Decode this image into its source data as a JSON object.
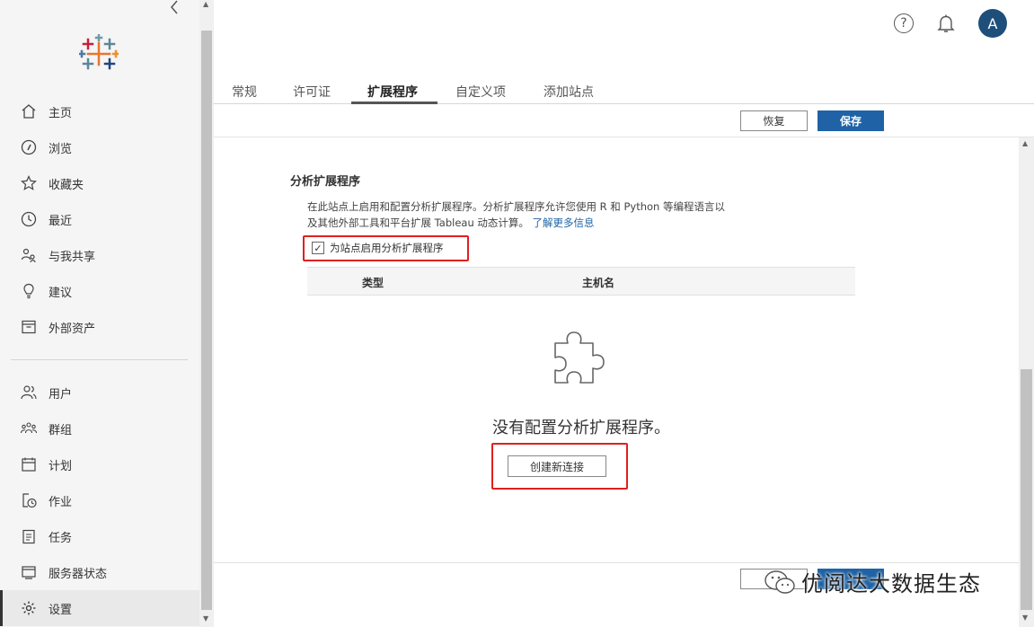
{
  "sidebar": {
    "items": [
      {
        "label": "主页",
        "icon": "home-icon"
      },
      {
        "label": "浏览",
        "icon": "compass-icon"
      },
      {
        "label": "收藏夹",
        "icon": "star-icon"
      },
      {
        "label": "最近",
        "icon": "clock-icon"
      },
      {
        "label": "与我共享",
        "icon": "shared-icon"
      },
      {
        "label": "建议",
        "icon": "lightbulb-icon"
      },
      {
        "label": "外部资产",
        "icon": "archive-icon"
      }
    ],
    "admin_items": [
      {
        "label": "用户",
        "icon": "user-icon"
      },
      {
        "label": "群组",
        "icon": "group-icon"
      },
      {
        "label": "计划",
        "icon": "calendar-icon"
      },
      {
        "label": "作业",
        "icon": "job-icon"
      },
      {
        "label": "任务",
        "icon": "task-icon"
      },
      {
        "label": "服务器状态",
        "icon": "server-status-icon"
      },
      {
        "label": "设置",
        "icon": "gear-icon",
        "active": true
      }
    ]
  },
  "header": {
    "avatar_letter": "A"
  },
  "tabs": [
    {
      "label": "常规"
    },
    {
      "label": "许可证"
    },
    {
      "label": "扩展程序",
      "active": true
    },
    {
      "label": "自定义项"
    },
    {
      "label": "添加站点"
    }
  ],
  "toolbar": {
    "restore_label": "恢复",
    "save_label": "保存"
  },
  "section": {
    "title": "分析扩展程序",
    "desc_line1": "在此站点上启用和配置分析扩展程序。分析扩展程序允许您使用 R 和 Python 等编程语言以",
    "desc_line2": "及其他外部工具和平台扩展 Tableau 动态计算。",
    "learn_more": "了解更多信息",
    "checkbox_label": "为站点启用分析扩展程序",
    "checkbox_checked": true
  },
  "table": {
    "col_type": "类型",
    "col_host": "主机名"
  },
  "empty": {
    "message": "没有配置分析扩展程序。",
    "create_label": "创建新连接"
  },
  "watermark": {
    "text": "优阅达大数据生态"
  },
  "colors": {
    "accent": "#1f63a6",
    "highlight": "#e0201e",
    "avatar": "#1e4f7a"
  }
}
